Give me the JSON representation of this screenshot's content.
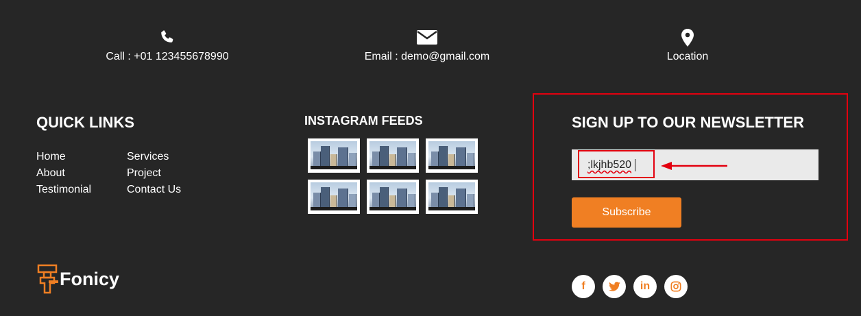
{
  "contacts": {
    "call": {
      "label": "Call : +01 123455678990",
      "icon": "phone-icon"
    },
    "email": {
      "label": "Email : demo@gmail.com",
      "icon": "envelope-icon"
    },
    "location": {
      "label": "Location",
      "icon": "map-pin-icon"
    }
  },
  "quick_links": {
    "title": "QUICK LINKS",
    "col1": [
      "Home",
      "About",
      "Testimonial"
    ],
    "col2": [
      "Services",
      "Project",
      "Contact Us"
    ]
  },
  "instagram": {
    "title": "INSTAGRAM FEEDS",
    "count": 6
  },
  "newsletter": {
    "title": "SIGN UP TO OUR NEWSLETTER",
    "input_value": ";lkjhb520",
    "button_label": "Subscribe"
  },
  "brand": {
    "logo_text": "Fonicy",
    "accent_color": "#f07f23"
  },
  "social": {
    "facebook": "f",
    "twitter": "twitter-icon",
    "linkedin": "in",
    "instagram": "instagram-icon"
  },
  "colors": {
    "background": "#262626",
    "accent": "#f07f23",
    "annotation": "#e3000f"
  }
}
